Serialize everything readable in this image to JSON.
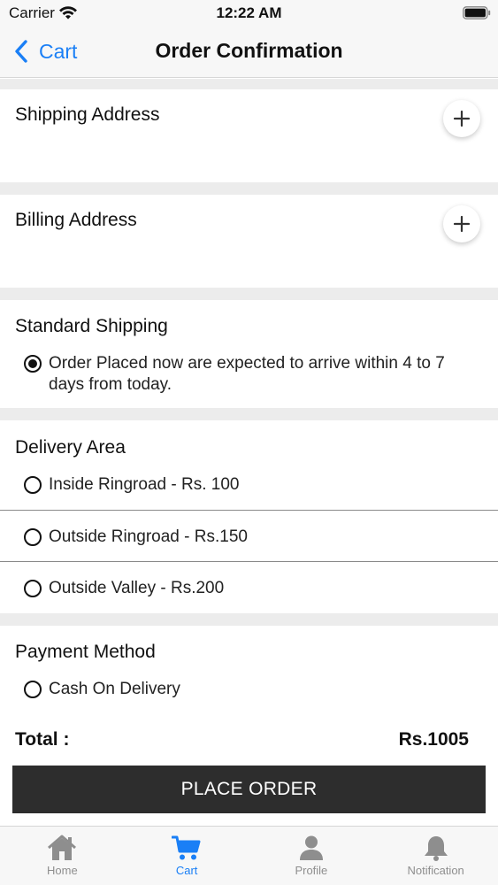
{
  "status_bar": {
    "carrier": "Carrier",
    "time": "12:22 AM"
  },
  "nav": {
    "back_label": "Cart",
    "title": "Order Confirmation"
  },
  "shipping_address": {
    "title": "Shipping Address",
    "add_icon": "plus-icon"
  },
  "billing_address": {
    "title": "Billing Address",
    "add_icon": "plus-icon"
  },
  "standard_shipping": {
    "title": "Standard Shipping",
    "option": {
      "label": "Order Placed now are expected to arrive within 4 to 7 days from today.",
      "selected": true
    }
  },
  "delivery_area": {
    "title": "Delivery Area",
    "options": [
      {
        "label": "Inside Ringroad - Rs. 100",
        "selected": false
      },
      {
        "label": "Outside Ringroad - Rs.150",
        "selected": false
      },
      {
        "label": "Outside Valley - Rs.200",
        "selected": false
      }
    ]
  },
  "payment_method": {
    "title": "Payment Method",
    "options": [
      {
        "label": "Cash On Delivery",
        "selected": false
      }
    ]
  },
  "total": {
    "label": "Total :",
    "value": "Rs.1005"
  },
  "place_order_label": "PLACE ORDER",
  "tabs": [
    {
      "label": "Home",
      "icon": "home-icon",
      "active": false
    },
    {
      "label": "Cart",
      "icon": "cart-icon",
      "active": true
    },
    {
      "label": "Profile",
      "icon": "profile-icon",
      "active": false
    },
    {
      "label": "Notification",
      "icon": "bell-icon",
      "active": false
    }
  ],
  "colors": {
    "accent": "#1a7ff6",
    "inactive": "#8e8e8e",
    "button_bg": "#2d2d2d",
    "separator": "#ececec"
  }
}
